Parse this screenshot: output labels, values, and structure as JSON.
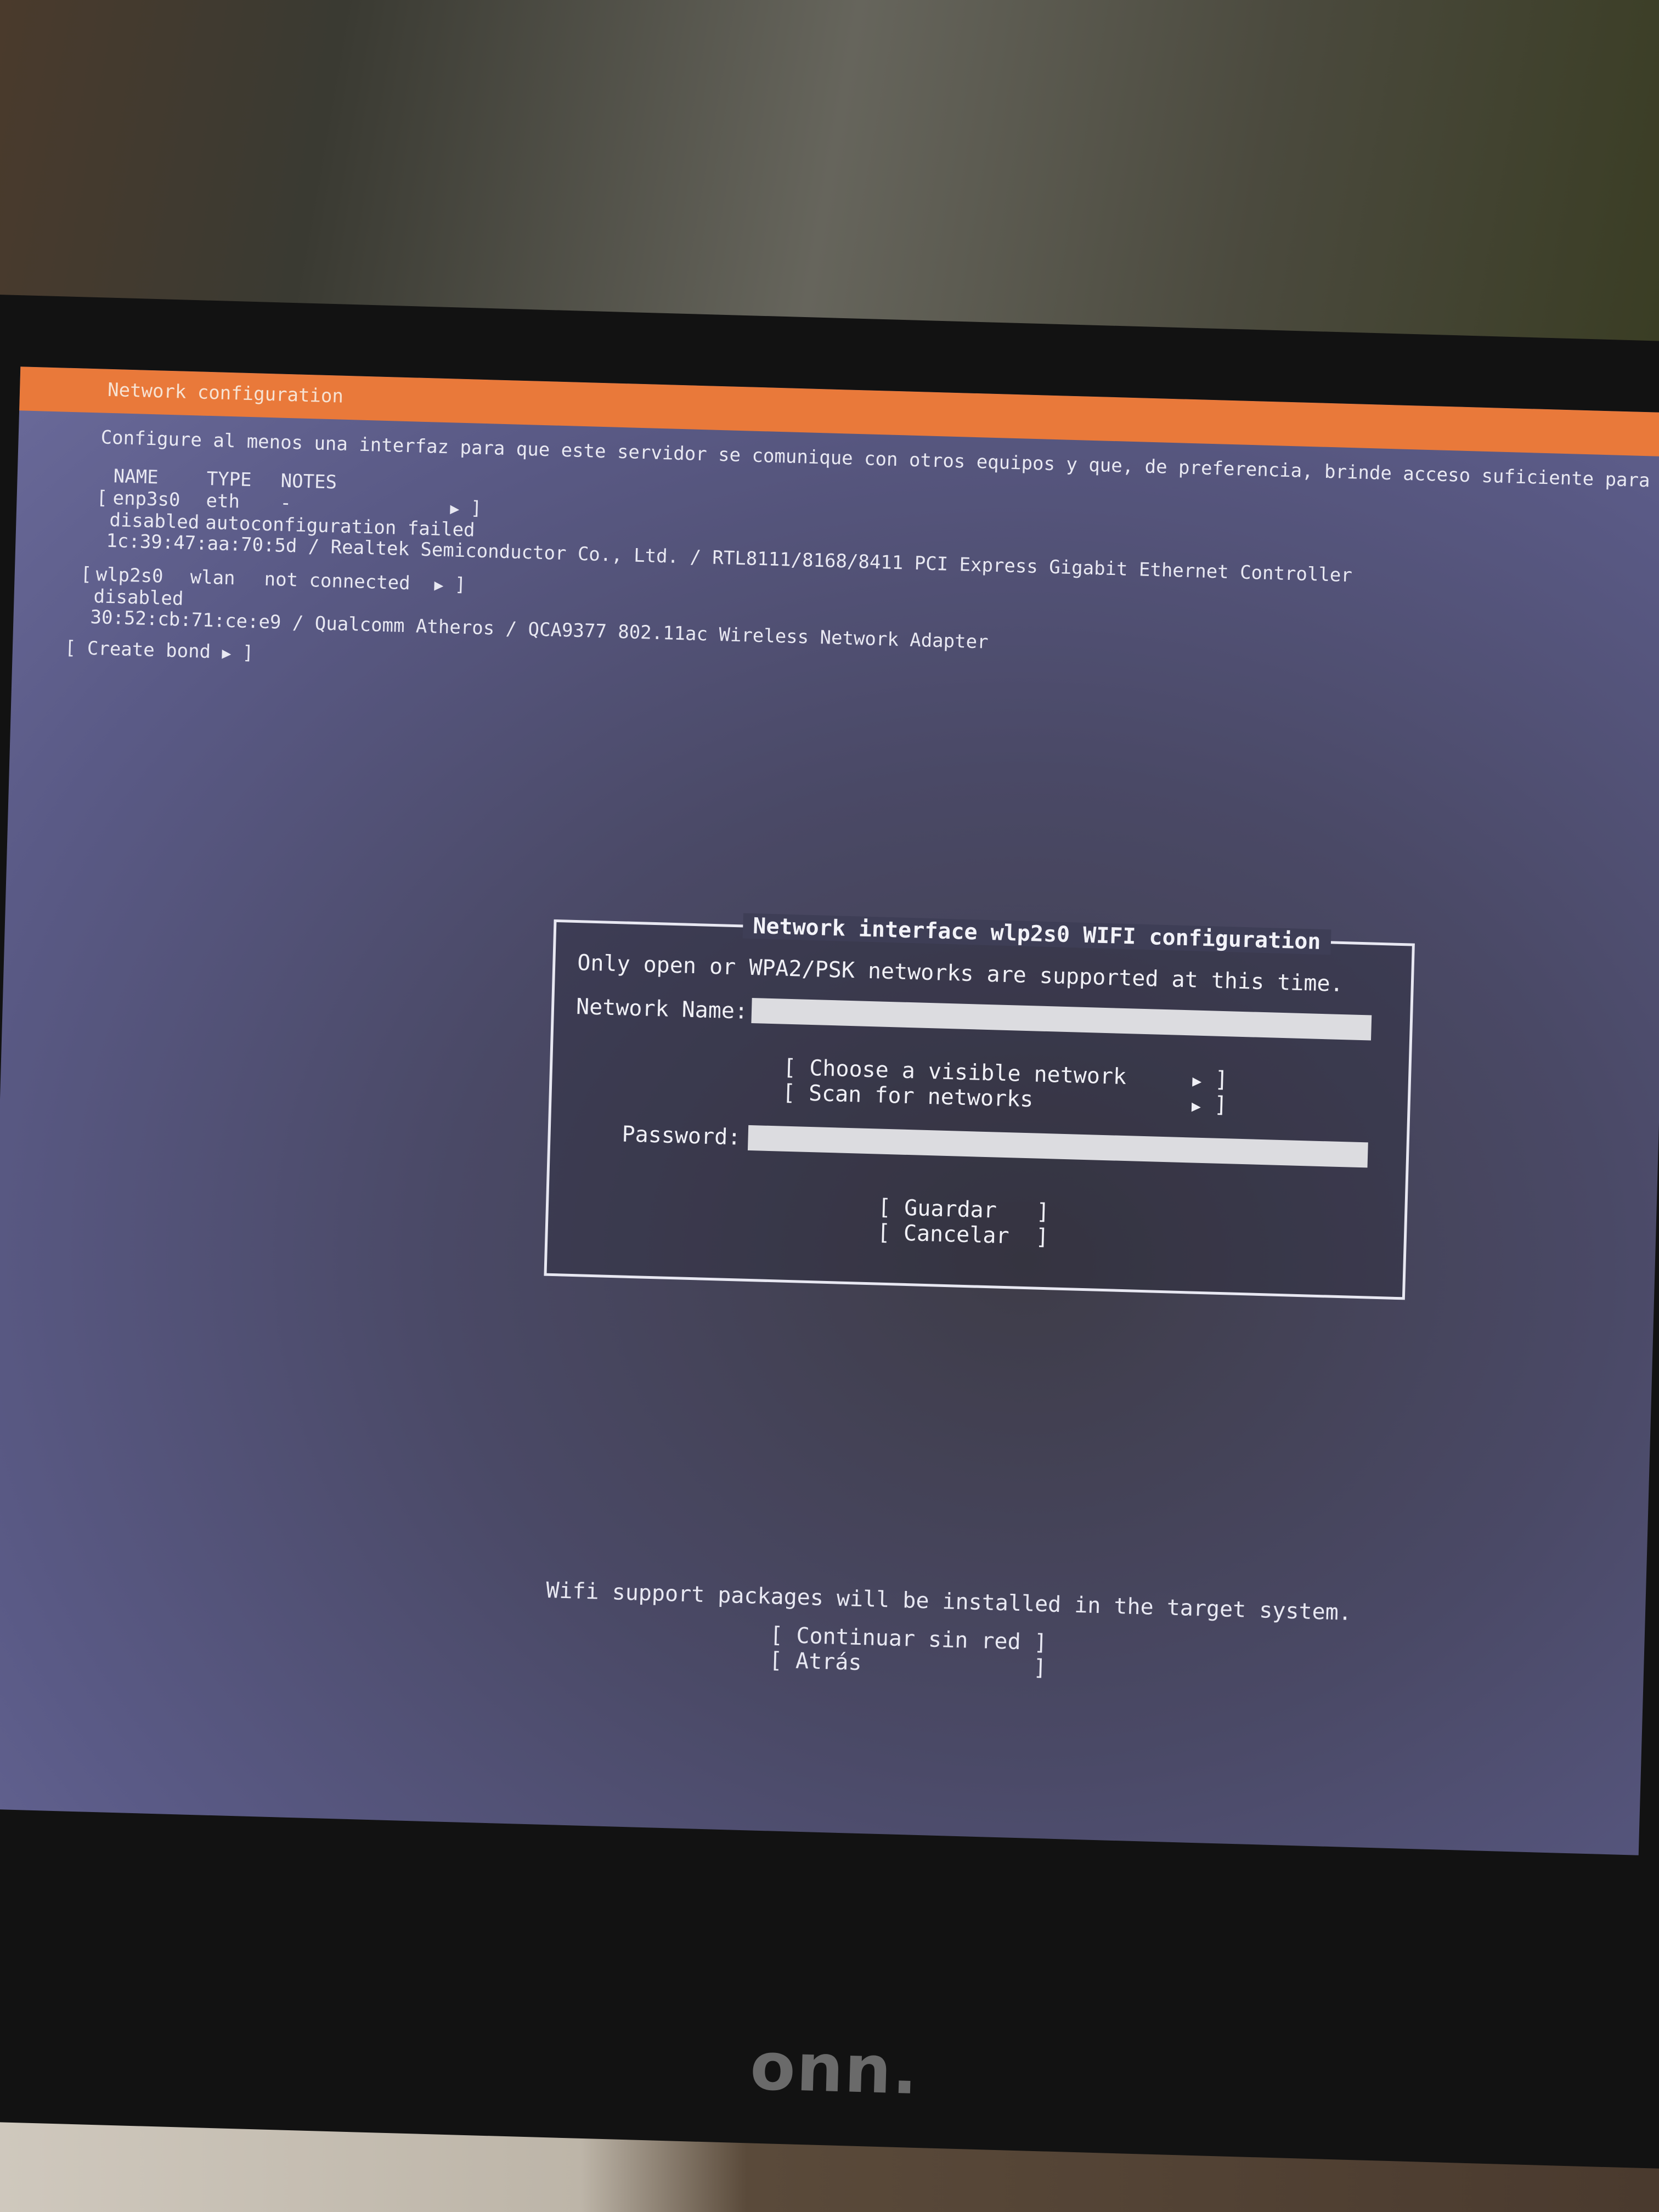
{
  "header": {
    "title": "Network configuration"
  },
  "intro": "Configure al menos una interfaz para que este servidor se comunique con otros equipos y que, de preferencia, brinde acceso suficiente para las actua",
  "table": {
    "columns": [
      "NAME",
      "TYPE",
      "NOTES"
    ],
    "interfaces": [
      {
        "name": "enp3s0",
        "type": "eth",
        "notes": "-",
        "status": "disabled",
        "status_note": "autoconfiguration failed",
        "hardware": "1c:39:47:aa:70:5d / Realtek Semiconductor Co., Ltd. / RTL8111/8168/8411 PCI Express Gigabit Ethernet Controller"
      },
      {
        "name": "wlp2s0",
        "type": "wlan",
        "notes": "not connected",
        "status": "disabled",
        "status_note": "",
        "hardware": "30:52:cb:71:ce:e9 / Qualcomm Atheros / QCA9377 802.11ac Wireless Network Adapter"
      }
    ],
    "create_bond": "Create bond"
  },
  "dialog": {
    "title": "Network interface wlp2s0 WIFI configuration",
    "subtitle": "Only open or WPA2/PSK networks are supported at this time.",
    "network_name_label": "Network Name:",
    "choose_visible": "Choose a visible network",
    "scan": "Scan for networks",
    "password_label": "Password:",
    "save": "Guardar",
    "cancel": "Cancelar"
  },
  "footer": {
    "note": "Wifi support packages will be installed in the target system.",
    "continue": "Continuar sin red",
    "back": "Atrás"
  },
  "bezel": {
    "brand": "onn."
  },
  "colors": {
    "title_bar": "#e9793a",
    "screen_bg": "#55557f",
    "text": "#e8e8f2"
  }
}
